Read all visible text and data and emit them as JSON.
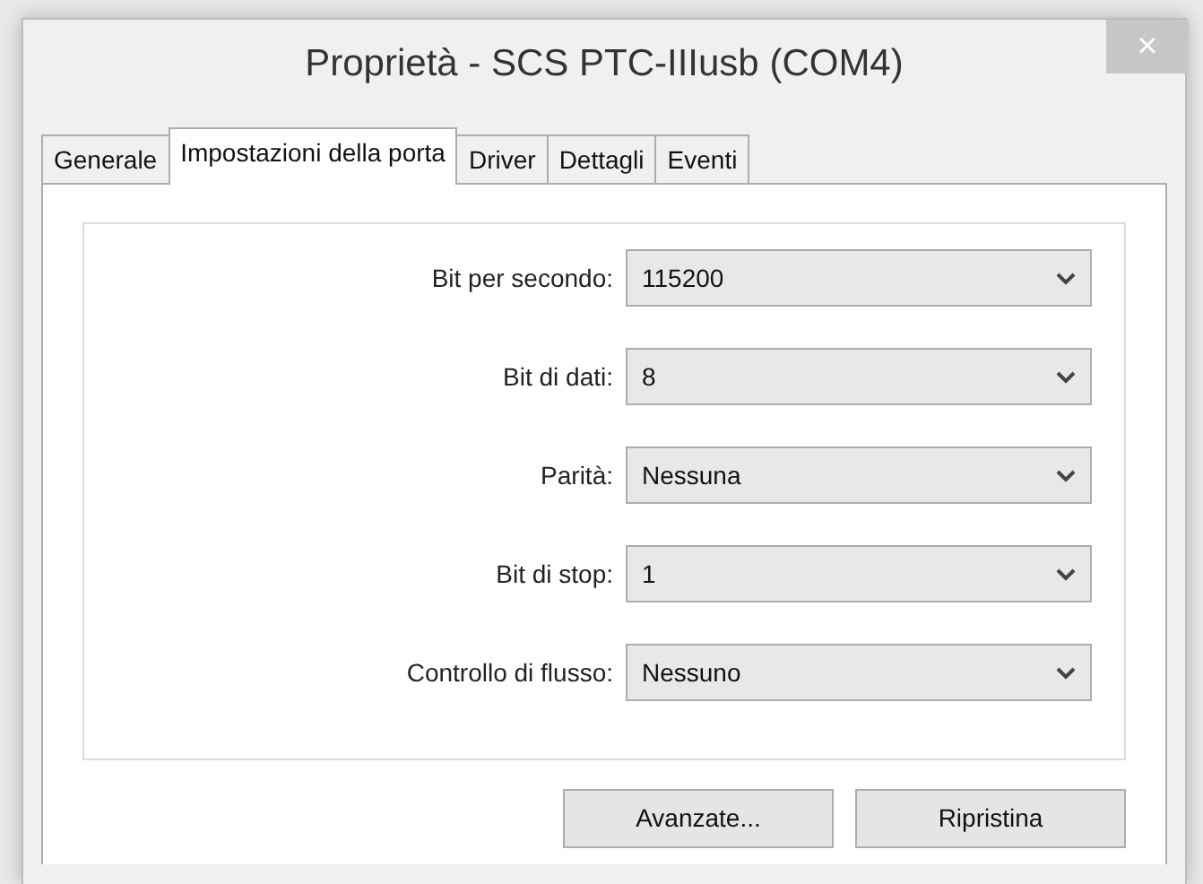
{
  "window": {
    "title": "Proprietà - SCS PTC-IIIusb (COM4)",
    "close": "×"
  },
  "tabs": [
    {
      "label": "Generale",
      "selected": false
    },
    {
      "label": "Impostazioni della porta",
      "selected": true
    },
    {
      "label": "Driver",
      "selected": false
    },
    {
      "label": "Dettagli",
      "selected": false
    },
    {
      "label": "Eventi",
      "selected": false
    }
  ],
  "settings": [
    {
      "label": "Bit per secondo:",
      "value": "115200"
    },
    {
      "label": "Bit di dati:",
      "value": "8"
    },
    {
      "label": "Parità:",
      "value": "Nessuna"
    },
    {
      "label": "Bit di stop:",
      "value": "1"
    },
    {
      "label": "Controllo di flusso:",
      "value": "Nessuno"
    }
  ],
  "buttons": [
    "Avanzate...",
    "Ripristina"
  ]
}
